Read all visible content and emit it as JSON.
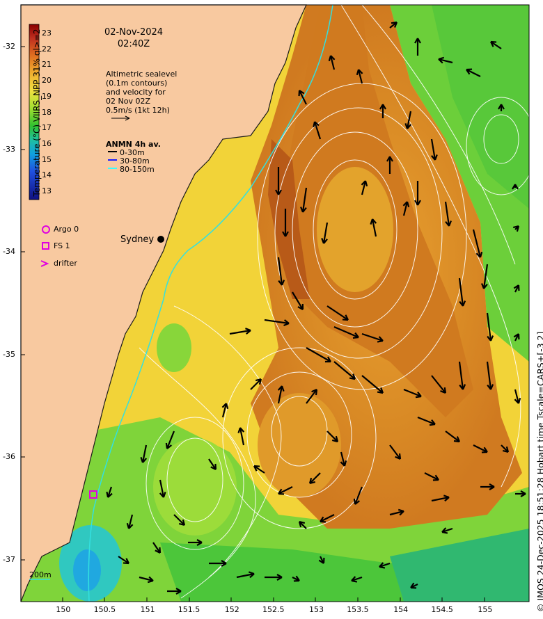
{
  "header": {
    "date": "02-Nov-2024",
    "time": "02:40Z"
  },
  "info": {
    "line1": "Altimetric sealevel",
    "line2": "(0.1m contours)",
    "line3": "and velocity for",
    "line4": "02 Nov 02Z",
    "line5": "0.5m/s (1kt 12h)"
  },
  "anmn": {
    "title": "ANMN 4h av.",
    "items": [
      {
        "label": "0-30m",
        "color": "#000000"
      },
      {
        "label": "30-80m",
        "color": "#1a1aff"
      },
      {
        "label": "80-150m",
        "color": "#33ffff"
      }
    ]
  },
  "colorbar": {
    "label": "Temperature (°C) VIIRS_NPP 31% ql>=2",
    "ticks": [
      "23",
      "22",
      "21",
      "20",
      "19",
      "18",
      "17",
      "16",
      "15",
      "14",
      "13"
    ]
  },
  "legend": {
    "argo": "Argo 0",
    "fs": "FS 1",
    "drifter": "drifter"
  },
  "places": {
    "sydney": "Sydney",
    "isobath": "200m"
  },
  "axes": {
    "lat_ticks": [
      "-32",
      "-33",
      "-34",
      "-35",
      "-36",
      "-37"
    ],
    "lon_ticks": [
      "150",
      "150.5",
      "151",
      "151.5",
      "152",
      "152.5",
      "153",
      "153.5",
      "154",
      "154.5",
      "155"
    ]
  },
  "credit": "© IMOS 24-Dec-2025 18:51:28 Hobart time Tscale=CARS+[-3 2]",
  "colors": {
    "land": "#f8c9a0",
    "warm": "#d9821f",
    "mid": "#f0d040",
    "cool": "#33cc33",
    "cold": "#00c8c8"
  }
}
